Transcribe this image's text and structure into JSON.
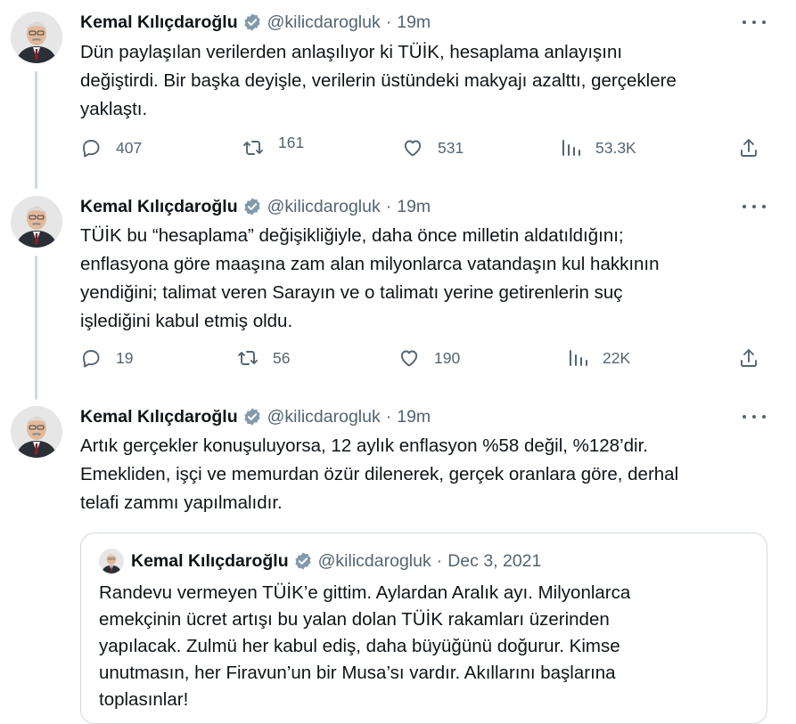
{
  "colors": {
    "verified": "#829aab",
    "muted": "#536471",
    "border": "#cfd9de"
  },
  "icons": {
    "reply": "reply-icon",
    "retweet": "retweet-icon",
    "like": "heart-icon",
    "views": "views-icon",
    "share": "share-icon",
    "more": "more-icon"
  },
  "tweets": [
    {
      "name": "Kemal Kılıçdaroğlu",
      "handle": "@kilicdarogluk",
      "sep": "·",
      "time": "19m",
      "lines": [
        "Dün paylaşılan verilerden anlaşılıyor ki TÜİK, hesaplama anlayışını",
        "değiştirdi. Bir başka deyişle, verilerin üstündeki makyajı azalttı, gerçeklere",
        "yaklaştı."
      ],
      "replies": "407",
      "retweets": "161",
      "likes": "531",
      "views": "53.3K"
    },
    {
      "name": "Kemal Kılıçdaroğlu",
      "handle": "@kilicdarogluk",
      "sep": "·",
      "time": "19m",
      "lines": [
        "TÜİK bu “hesaplama” değişikliğiyle, daha önce milletin aldatıldığını;",
        "enflasyona göre maaşına zam alan milyonlarca vatandaşın kul hakkının",
        "yendiğini; talimat veren Sarayın ve o talimatı yerine getirenlerin suç",
        "işlediğini kabul etmiş oldu."
      ],
      "replies": "19",
      "retweets": "56",
      "likes": "190",
      "views": "22K"
    },
    {
      "name": "Kemal Kılıçdaroğlu",
      "handle": "@kilicdarogluk",
      "sep": "·",
      "time": "19m",
      "lines": [
        "Artık gerçekler konuşuluyorsa, 12 aylık enflasyon %58 değil, %128’dir.",
        "Emekliden, işçi ve memurdan özür dilenerek, gerçek oranlara göre, derhal",
        "telafi zammı yapılmalıdır."
      ]
    }
  ],
  "quote": {
    "name": "Kemal Kılıçdaroğlu",
    "handle": "@kilicdarogluk",
    "sep": "·",
    "date": "Dec 3, 2021",
    "lines": [
      "Randevu vermeyen TÜİK’e gittim. Aylardan Aralık ayı. Milyonlarca",
      "emekçinin ücret artışı bu yalan dolan TÜİK rakamları üzerinden",
      "yapılacak. Zulmü her kabul ediş, daha büyüğünü doğurur. Kimse",
      "unutmasın, her Firavun’un bir Musa’sı vardır. Akıllarını başlarına",
      "toplasınlar!"
    ]
  }
}
